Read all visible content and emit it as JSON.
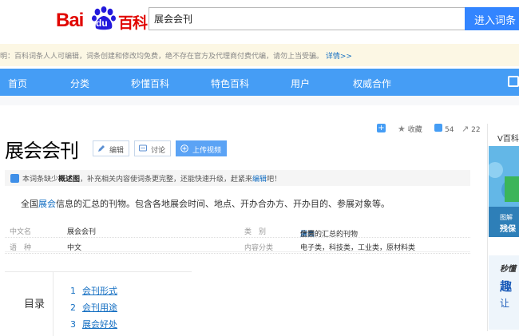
{
  "header": {
    "logo_bai": "Bai",
    "logo_du": "du",
    "logo_baike": "百科",
    "search_value": "展会会刊",
    "search_button": "进入词条"
  },
  "notice": {
    "text": "明：百科词条人人可编辑，词条创建和修改均免费，绝不存在官方及代理商付费代编，请勿上当受骗。",
    "link": "详情>>"
  },
  "nav": {
    "items": [
      "首页",
      "分类",
      "秒懂百科",
      "特色百科",
      "用户",
      "权威合作"
    ]
  },
  "actions": {
    "collect": "收藏",
    "likes": "54",
    "shares": "22"
  },
  "title": "展会会刊",
  "buttons": {
    "edit": "编辑",
    "discuss": "讨论",
    "upload_video": "上传视频"
  },
  "warn": {
    "pre": "本词条缺少",
    "bold": "概述图",
    "mid": "，补充相关内容使词条更完整，还能快速升级，赶紧来",
    "link": "编辑",
    "post": "吧！"
  },
  "summary": {
    "pre": "全国",
    "link": "展会",
    "post": "信息的汇总的刊物。包含各地展会时间、地点、开办合办方、开办目的、参展对象等。"
  },
  "info": {
    "r1_l1": "中文名",
    "r1_v1": "展会会刊",
    "r1_l2": "类　别",
    "r1_v2_pre": "全国",
    "r1_v2_link": "展会",
    "r1_v2_post": "信息的汇总的刊物",
    "r2_l1": "语　种",
    "r2_v1": "中文",
    "r2_l2": "内容分类",
    "r2_v2": "电子类，科技类，工业类，原材料类"
  },
  "toc": {
    "label": "目录",
    "items": [
      {
        "num": "1",
        "text": "会刊形式"
      },
      {
        "num": "2",
        "text": "会刊用途"
      },
      {
        "num": "3",
        "text": "展会好处"
      }
    ]
  },
  "sidebar": {
    "label": "V百科",
    "card1_line1": "图解",
    "card1_line2": "残保",
    "card2_brand": "秒懂",
    "card2_big": "趣",
    "card2_small": "让"
  },
  "colors": {
    "nav_bg": "#459df5",
    "search_button": "#3385ff",
    "logo_red": "#e10601",
    "link_blue": "#136ec2"
  }
}
